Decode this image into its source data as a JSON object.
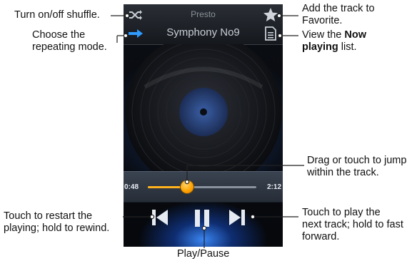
{
  "player": {
    "artist": "Presto",
    "title": "Symphony No9",
    "elapsed": "0:48",
    "total": "2:12",
    "progress": 0.36,
    "icons": {
      "shuffle": "shuffle-icon",
      "repeat": "repeat-arrow-icon",
      "favorite": "star-icon",
      "now_playing_list": "list-document-icon",
      "previous": "skip-previous-icon",
      "pause": "pause-icon",
      "next": "skip-next-icon"
    },
    "colors": {
      "accent": "#ffa300",
      "repeat_icon": "#2f9bff",
      "glow": "#3c8cff"
    }
  },
  "callouts": {
    "shuffle": "Turn on/off shuffle.",
    "repeat_line1": "Choose the",
    "repeat_line2": "repeating mode.",
    "favorite_line1": "Add the track to",
    "favorite_line2": "Favorite.",
    "list_pre": "View the ",
    "list_bold1": "Now",
    "list_bold2": "playing",
    "list_post": " list.",
    "seek_line1": "Drag or touch to jump",
    "seek_line2": "within the track.",
    "restart_line1": "Touch to restart the",
    "restart_line2": "playing; hold to rewind.",
    "next_line1": "Touch to play the",
    "next_line2": "next track; hold to fast",
    "next_line3": "forward.",
    "playpause": "Play/Pause"
  }
}
